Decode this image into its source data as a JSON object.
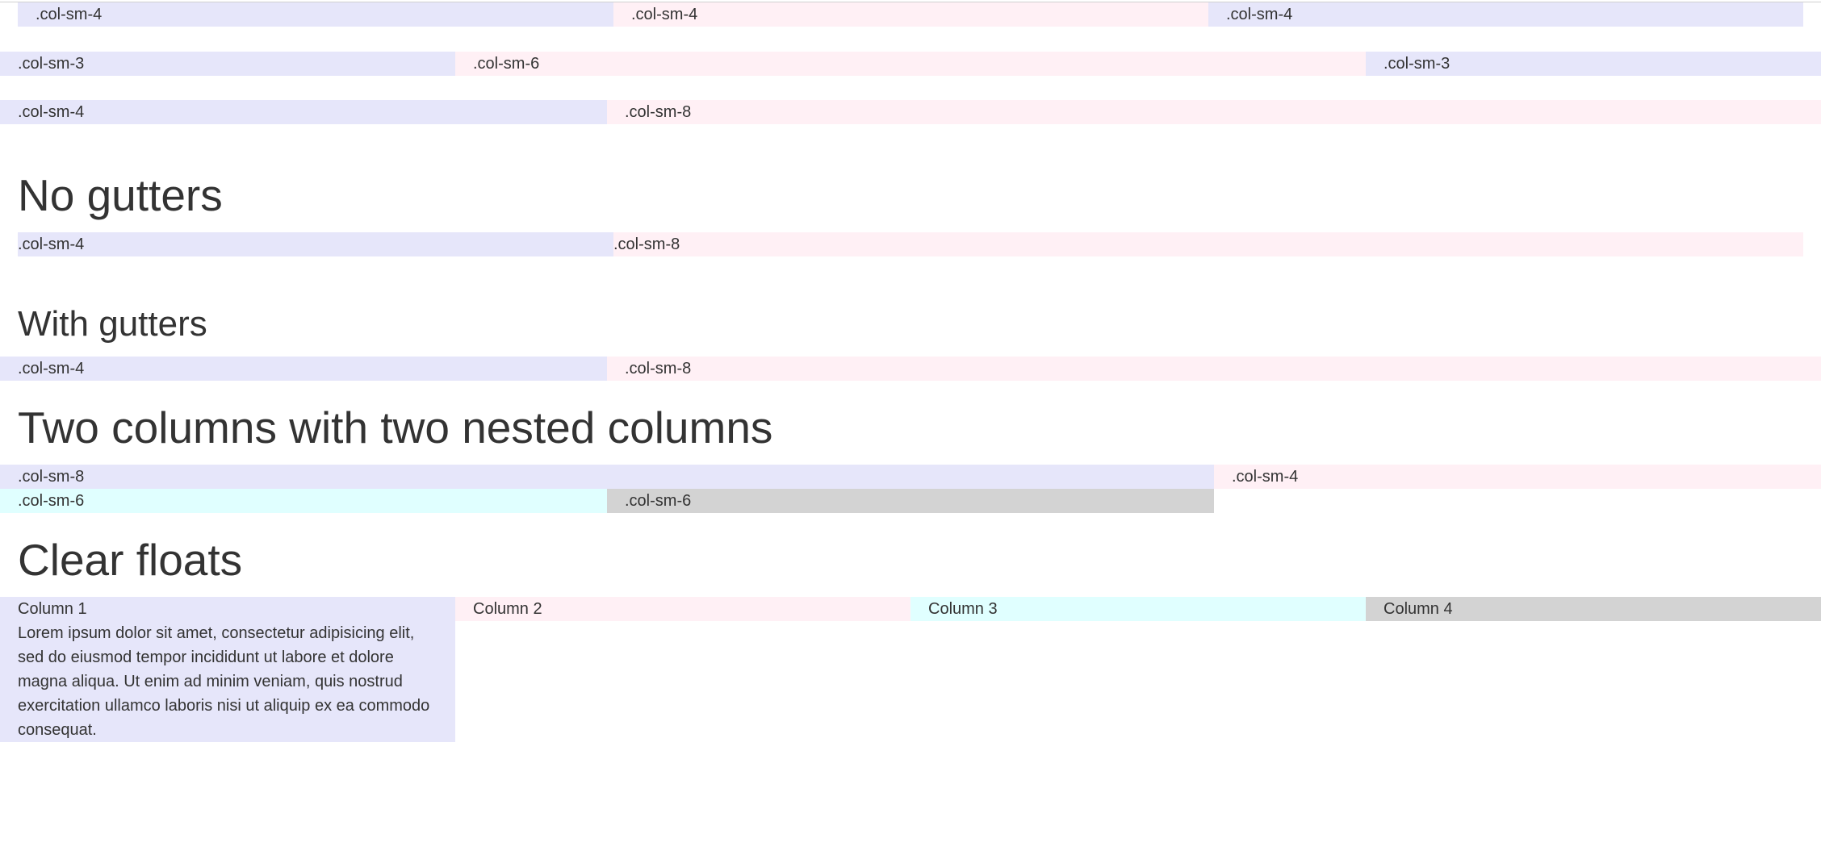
{
  "rows": {
    "row1": [
      ".col-sm-4",
      ".col-sm-4",
      ".col-sm-4"
    ],
    "row2": [
      ".col-sm-3",
      ".col-sm-6",
      ".col-sm-3"
    ],
    "row3": [
      ".col-sm-4",
      ".col-sm-8"
    ]
  },
  "no_gutters": {
    "title": "No gutters",
    "cols": [
      ".col-sm-4",
      ".col-sm-8"
    ]
  },
  "with_gutters": {
    "title": "With gutters",
    "cols": [
      ".col-sm-4",
      ".col-sm-8"
    ]
  },
  "nested": {
    "title": "Two columns with two nested columns",
    "outer": [
      ".col-sm-8",
      ".col-sm-4"
    ],
    "inner": [
      ".col-sm-6",
      ".col-sm-6"
    ]
  },
  "clear_floats": {
    "title": "Clear floats",
    "columns": [
      "Column 1",
      "Column 2",
      "Column 3",
      "Column 4"
    ],
    "paragraph": "Lorem ipsum dolor sit amet, consectetur adipisicing elit, sed do eiusmod tempor incididunt ut labore et dolore magna aliqua. Ut enim ad minim veniam, quis nostrud exercitation ullamco laboris nisi ut aliquip ex ea commodo consequat."
  },
  "colors": {
    "lavender": "#e6e6fa",
    "lavenderblush": "#fff0f5",
    "lightcyan": "#e0ffff",
    "lightgray": "#d3d3d3",
    "text": "#333333"
  }
}
